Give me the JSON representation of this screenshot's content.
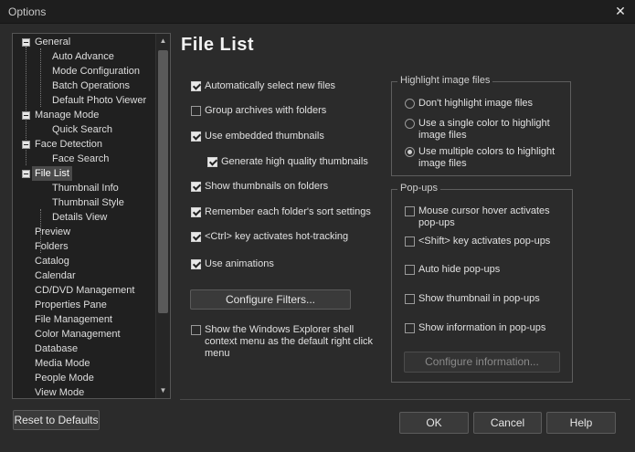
{
  "window": {
    "title": "Options",
    "close_glyph": "✕"
  },
  "tree": {
    "items": [
      {
        "label": "General",
        "level": 0,
        "expanded": true
      },
      {
        "label": "Auto Advance",
        "level": 1
      },
      {
        "label": "Mode Configuration",
        "level": 1
      },
      {
        "label": "Batch Operations",
        "level": 1
      },
      {
        "label": "Default Photo Viewer",
        "level": 1
      },
      {
        "label": "Manage Mode",
        "level": 0,
        "expanded": true
      },
      {
        "label": "Quick Search",
        "level": 1
      },
      {
        "label": "Face Detection",
        "level": 0,
        "expanded": true
      },
      {
        "label": "Face Search",
        "level": 1
      },
      {
        "label": "File List",
        "level": 0,
        "expanded": true,
        "selected": true
      },
      {
        "label": "Thumbnail Info",
        "level": 1
      },
      {
        "label": "Thumbnail Style",
        "level": 1
      },
      {
        "label": "Details View",
        "level": 1
      },
      {
        "label": "Preview",
        "level": 0
      },
      {
        "label": "Folders",
        "level": 0
      },
      {
        "label": "Catalog",
        "level": 0
      },
      {
        "label": "Calendar",
        "level": 0
      },
      {
        "label": "CD/DVD Management",
        "level": 0
      },
      {
        "label": "Properties Pane",
        "level": 0
      },
      {
        "label": "File Management",
        "level": 0
      },
      {
        "label": "Color Management",
        "level": 0
      },
      {
        "label": "Database",
        "level": 0
      },
      {
        "label": "Media Mode",
        "level": 0
      },
      {
        "label": "People Mode",
        "level": 0
      },
      {
        "label": "View Mode",
        "level": 0
      }
    ]
  },
  "page": {
    "title": "File List"
  },
  "options": {
    "auto_select": {
      "label": "Automatically select new files",
      "checked": true
    },
    "group_archives": {
      "label": "Group archives with folders",
      "checked": false
    },
    "embedded_thumbs": {
      "label": "Use embedded thumbnails",
      "checked": true
    },
    "hq_thumbs": {
      "label": "Generate high quality thumbnails",
      "checked": true
    },
    "thumbs_on_folders": {
      "label": "Show thumbnails on folders",
      "checked": true
    },
    "remember_sort": {
      "label": "Remember each folder's sort settings",
      "checked": true
    },
    "ctrl_hot": {
      "label": "<Ctrl> key activates hot-tracking",
      "checked": true
    },
    "animations": {
      "label": "Use animations",
      "checked": true
    },
    "explorer_menu": {
      "label": "Show the Windows Explorer shell context menu as the default right click menu",
      "checked": false
    }
  },
  "buttons": {
    "configure_filters": "Configure Filters...",
    "configure_information": "Configure information...",
    "reset": "Reset to Defaults",
    "ok": "OK",
    "cancel": "Cancel",
    "help": "Help"
  },
  "highlight": {
    "legend": "Highlight image files",
    "options": [
      {
        "label": "Don't highlight image files",
        "selected": false
      },
      {
        "label": "Use a single color to highlight image files",
        "selected": false
      },
      {
        "label": "Use multiple colors to highlight image files",
        "selected": true
      }
    ]
  },
  "popups": {
    "legend": "Pop-ups",
    "hover": {
      "label": "Mouse cursor hover activates pop-ups",
      "checked": false
    },
    "shift": {
      "label": "<Shift> key activates pop-ups",
      "checked": false
    },
    "autohide": {
      "label": "Auto hide pop-ups",
      "checked": false
    },
    "thumb": {
      "label": "Show thumbnail in pop-ups",
      "checked": false
    },
    "info": {
      "label": "Show information in pop-ups",
      "checked": false
    }
  }
}
